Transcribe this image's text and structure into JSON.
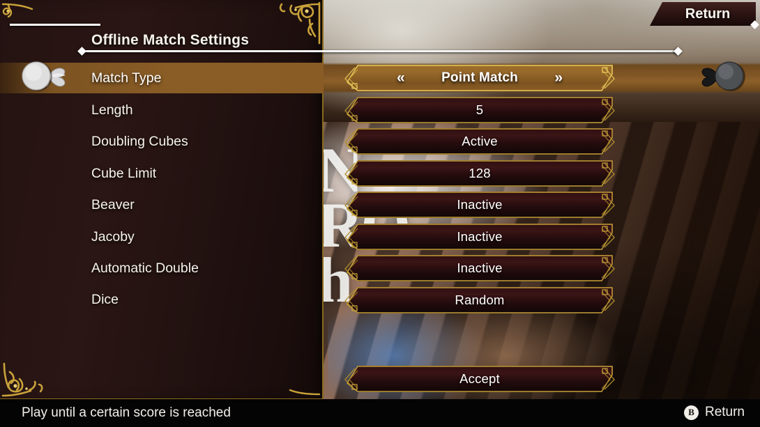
{
  "window": {
    "title": "Offline Match Settings"
  },
  "top_bar": {
    "return_label": "Return"
  },
  "background": {
    "watermark_text": "N\nRO\nh"
  },
  "settings": {
    "rows": [
      {
        "label": "Match Type",
        "value": "Point Match",
        "selected": true,
        "has_arrows": true
      },
      {
        "label": "Length",
        "value": "5",
        "selected": false,
        "has_arrows": false
      },
      {
        "label": "Doubling Cubes",
        "value": "Active",
        "selected": false,
        "has_arrows": false
      },
      {
        "label": "Cube Limit",
        "value": "128",
        "selected": false,
        "has_arrows": false
      },
      {
        "label": "Beaver",
        "value": "Inactive",
        "selected": false,
        "has_arrows": false
      },
      {
        "label": "Jacoby",
        "value": "Inactive",
        "selected": false,
        "has_arrows": false
      },
      {
        "label": "Automatic Double",
        "value": "Inactive",
        "selected": false,
        "has_arrows": false
      },
      {
        "label": "Dice",
        "value": "Random",
        "selected": false,
        "has_arrows": false
      }
    ],
    "prev_arrow": "«",
    "next_arrow": "»",
    "accept_label": "Accept"
  },
  "footer": {
    "hint": "Play until a certain score is reached",
    "button_glyph": "B",
    "button_action": "Return"
  },
  "colors": {
    "highlight_gold": "#8b5d24",
    "bar_dark": "#2e0f10",
    "bar_border_gold": "#c8a43a",
    "panel_bg": "#241312",
    "text_primary": "#f6f3ec",
    "footer_bg": "#050405"
  }
}
